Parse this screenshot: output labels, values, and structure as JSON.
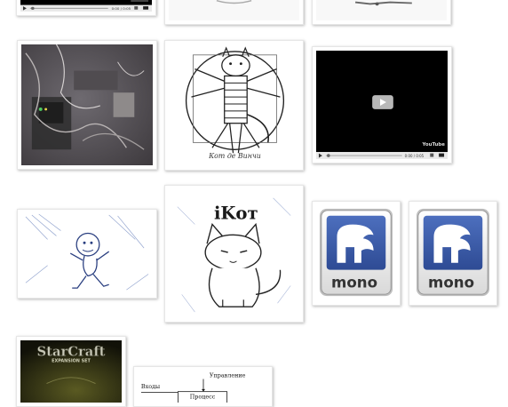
{
  "gallery": {
    "items": [
      {
        "name": "video-thumb-top",
        "kind": "youtube-player",
        "time": "0:00 / 0:05"
      },
      {
        "name": "image-thumb-top-middle",
        "kind": "photo"
      },
      {
        "name": "image-thumb-top-right",
        "kind": "photo"
      },
      {
        "name": "photo-electronics-desk",
        "kind": "photo"
      },
      {
        "name": "sketch-vitruvian-cat",
        "kind": "sketch",
        "caption": "Кот де Винчи"
      },
      {
        "name": "video-thumb-youtube",
        "kind": "youtube-player",
        "time": "0:00 / 0:05",
        "logo": "YouTube"
      },
      {
        "name": "sketch-running-character",
        "kind": "sketch"
      },
      {
        "name": "sketch-ikot-cat",
        "kind": "sketch",
        "caption": "iKот"
      },
      {
        "name": "mono-logo-thumb-1",
        "kind": "logo",
        "label": "mono"
      },
      {
        "name": "mono-logo-thumb-2",
        "kind": "logo",
        "label": "mono"
      },
      {
        "name": "starcraft-cover-thumb",
        "kind": "cover",
        "title": "StarCraft",
        "subtitle": "EXPANSION SET"
      },
      {
        "name": "process-diagram-thumb",
        "kind": "diagram",
        "labels": {
          "control": "Управление",
          "inputs": "Входы",
          "process": "Процесс"
        }
      }
    ]
  },
  "colors": {
    "mono_blue": "#3b5ba8",
    "thumb_border": "#e6e6e6",
    "player_black": "#000000"
  }
}
